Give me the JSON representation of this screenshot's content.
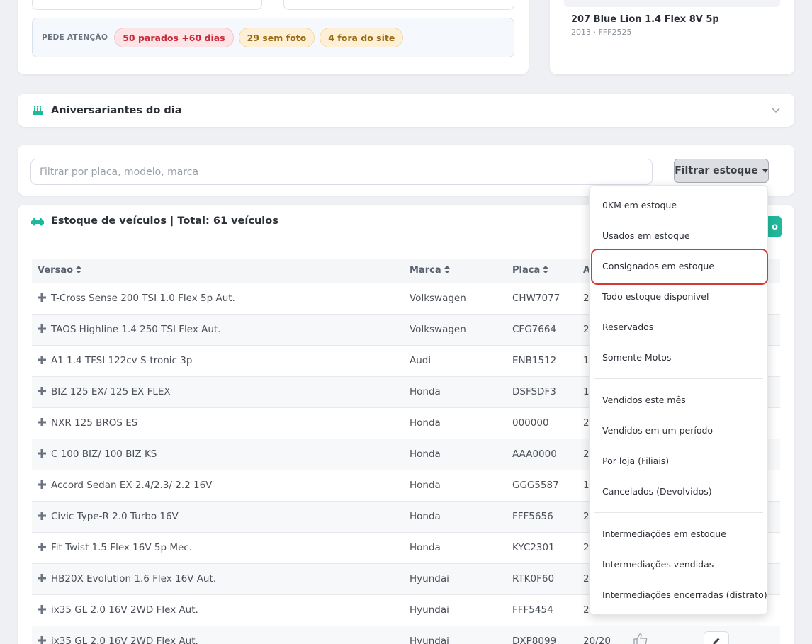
{
  "attention": {
    "label": "PEDE ATENÇÃO",
    "pill_parados": "50 parados +60 dias",
    "pill_sem_foto": "29 sem foto",
    "pill_fora_site": "4 fora do site"
  },
  "featured_car": {
    "name": "207 Blue Lion 1.4 Flex 8V 5p",
    "subtitle": "2013 · FFF2525"
  },
  "birthdays": {
    "title": "Aniversariantes do dia"
  },
  "filter": {
    "search_placeholder": "Filtrar por placa, modelo, marca",
    "button_label": "Filtrar estoque"
  },
  "inventory": {
    "title": "Estoque de veículos | Total: 61 veículos",
    "action_button_label": "o",
    "columns": [
      "Versão",
      "Marca",
      "Placa",
      "A"
    ],
    "rows": [
      {
        "versao": "T-Cross Sense 200 TSI 1.0 Flex 5p Aut.",
        "marca": "Volkswagen",
        "placa": "CHW7077",
        "ano": "2"
      },
      {
        "versao": "TAOS Highline 1.4 250 TSI Flex Aut.",
        "marca": "Volkswagen",
        "placa": "CFG7664",
        "ano": "2"
      },
      {
        "versao": "A1 1.4 TFSI 122cv S-tronic 3p",
        "marca": "Audi",
        "placa": "ENB1512",
        "ano": "1"
      },
      {
        "versao": "BIZ 125 EX/ 125 EX FLEX",
        "marca": "Honda",
        "placa": "DSFSDF3",
        "ano": "1"
      },
      {
        "versao": "NXR 125 BROS ES",
        "marca": "Honda",
        "placa": "000000",
        "ano": "2"
      },
      {
        "versao": "C 100 BIZ/ 100 BIZ KS",
        "marca": "Honda",
        "placa": "AAA0000",
        "ano": "2"
      },
      {
        "versao": "Accord Sedan EX 2.4/2.3/ 2.2 16V",
        "marca": "Honda",
        "placa": "GGG5587",
        "ano": "1"
      },
      {
        "versao": "Civic Type-R 2.0 Turbo 16V",
        "marca": "Honda",
        "placa": "FFF5656",
        "ano": "2"
      },
      {
        "versao": "Fit Twist 1.5 Flex 16V 5p Mec.",
        "marca": "Honda",
        "placa": "KYC2301",
        "ano": "2"
      },
      {
        "versao": "HB20X Evolution 1.6 Flex 16V Aut.",
        "marca": "Hyundai",
        "placa": "RTK0F60",
        "ano": "2"
      },
      {
        "versao": "ix35 GL 2.0 16V 2WD Flex Aut.",
        "marca": "Hyundai",
        "placa": "FFF5454",
        "ano": "2"
      },
      {
        "versao": "ix35 GL 2.0 16V 2WD Flex Aut.",
        "marca": "Hyundai",
        "placa": "DXP8099",
        "ano": "20/20"
      }
    ]
  },
  "dropdown": {
    "group1": [
      "0KM em estoque",
      "Usados em estoque",
      "Consignados em estoque",
      "Todo estoque disponível",
      "Reservados",
      "Somente Motos"
    ],
    "group2": [
      "Vendidos este mês",
      "Vendidos em um período",
      "Por loja (Filiais)",
      "Cancelados (Devolvidos)"
    ],
    "group3": [
      "Intermediações em estoque",
      "Intermediações vendidas",
      "Intermediações encerradas (distrato)"
    ]
  },
  "colors": {
    "accent_green": "#1fb89a",
    "alert_red": "#c8283a",
    "warn_yellow": "#9a6a10",
    "highlight_ring": "#d23a3a"
  }
}
